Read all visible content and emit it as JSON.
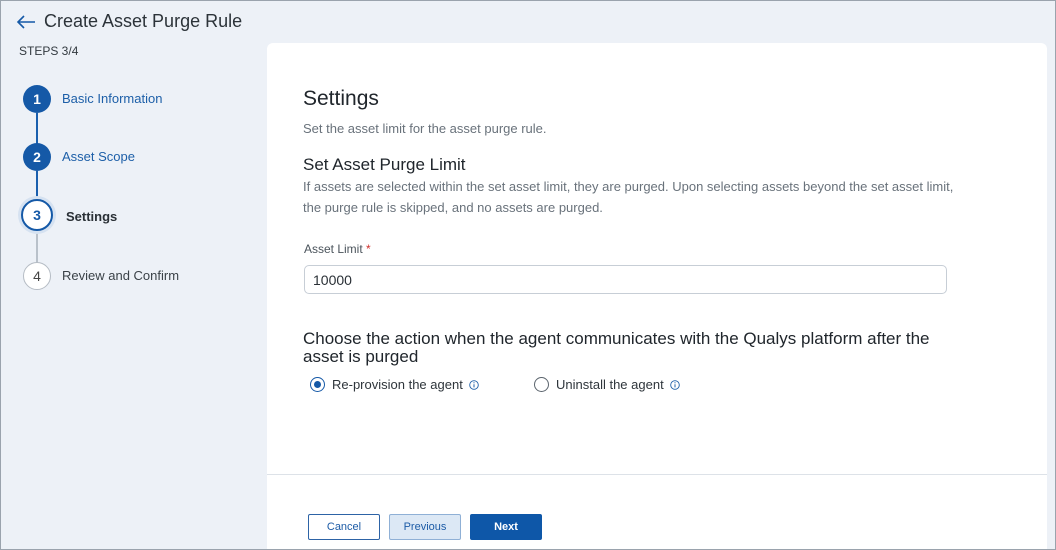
{
  "header": {
    "title": "Create Asset Purge Rule",
    "steps_label": "STEPS 3/4"
  },
  "stepper": {
    "steps": [
      {
        "number": "1",
        "label": "Basic Information",
        "state": "completed"
      },
      {
        "number": "2",
        "label": "Asset Scope",
        "state": "completed"
      },
      {
        "number": "3",
        "label": "Settings",
        "state": "current"
      },
      {
        "number": "4",
        "label": "Review and Confirm",
        "state": "upcoming"
      }
    ]
  },
  "settings": {
    "title": "Settings",
    "description": "Set the asset limit for the asset purge rule.",
    "purge_limit": {
      "title": "Set Asset Purge Limit",
      "description": "If assets are selected within the set asset limit, they are purged. Upon selecting assets beyond the set asset limit, the purge rule is skipped, and no assets are purged.",
      "field_label": "Asset Limit",
      "required_marker": "*",
      "value": "10000"
    },
    "action": {
      "title": "Choose the action when the agent communicates with the Qualys platform after the asset is purged",
      "options": [
        {
          "label": "Re-provision the agent",
          "selected": true
        },
        {
          "label": "Uninstall the agent",
          "selected": false
        }
      ]
    }
  },
  "footer": {
    "cancel_label": "Cancel",
    "previous_label": "Previous",
    "next_label": "Next"
  },
  "colors": {
    "primary": "#1559a7",
    "background": "#edf1f7",
    "required": "#d0312d"
  }
}
